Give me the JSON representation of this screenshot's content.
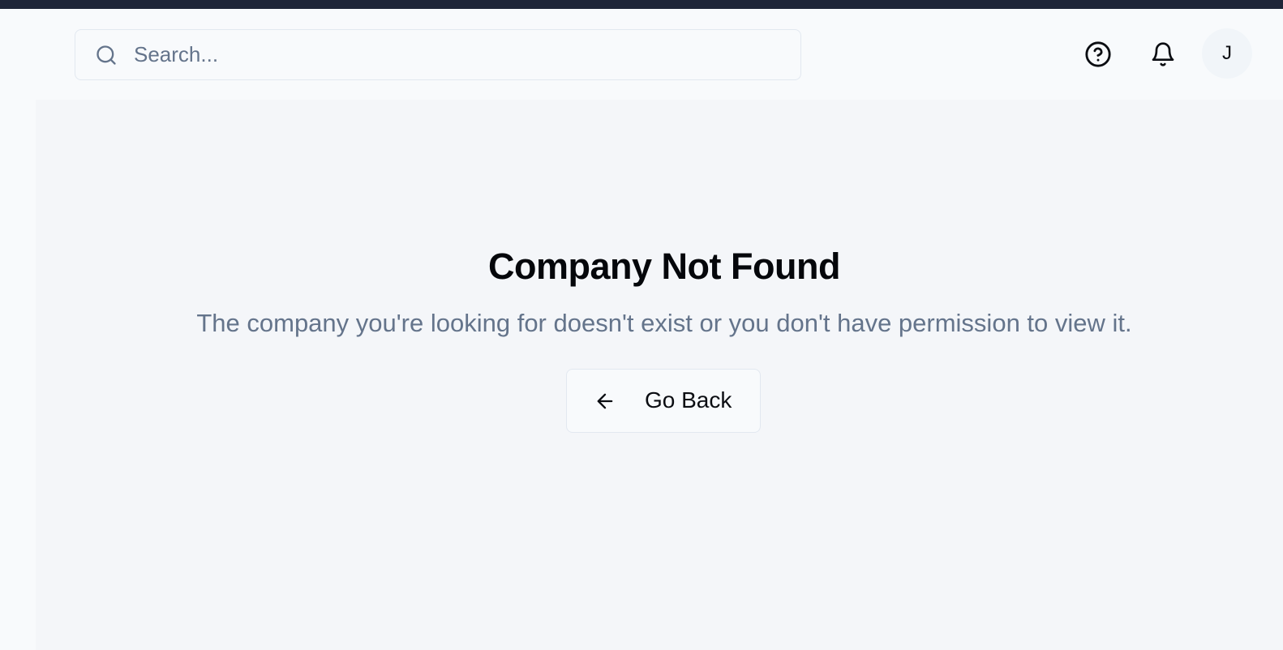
{
  "header": {
    "search": {
      "placeholder": "Search...",
      "value": "",
      "icon": "search-icon"
    },
    "help_icon": "help-circle-icon",
    "notifications_icon": "bell-icon",
    "avatar_initial": "J"
  },
  "main": {
    "title": "Company Not Found",
    "description": "The company you're looking for doesn't exist or you don't have permission to view it.",
    "back_button": {
      "label": "Go Back",
      "icon": "arrow-left-icon"
    }
  },
  "colors": {
    "topbar": "#1e2538",
    "background": "#f8fafc",
    "main_background": "#f4f6f9",
    "muted_text": "#64748b",
    "border": "#e2e8f0"
  }
}
